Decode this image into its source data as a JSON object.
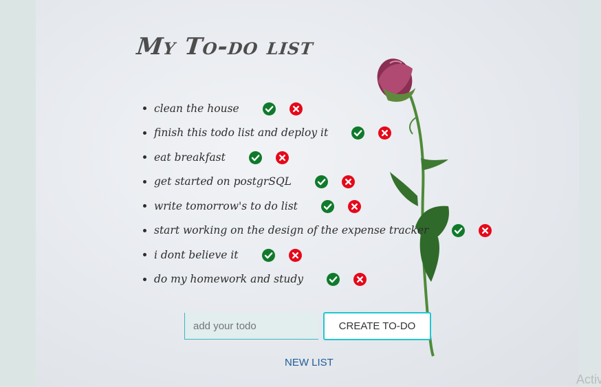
{
  "page": {
    "title": "My To-do list",
    "input_placeholder": "add your todo",
    "create_button": "CREATE TO-DO",
    "new_list_link": "NEW LIST",
    "watermark": "Activ"
  },
  "todos": [
    {
      "text": "clean the house"
    },
    {
      "text": "finish this todo list and deploy it"
    },
    {
      "text": "eat breakfast"
    },
    {
      "text": "get started on postgrSQL"
    },
    {
      "text": "write tomorrow's to do list"
    },
    {
      "text": "start working on the design of the expense tracker"
    },
    {
      "text": "i dont believe it"
    },
    {
      "text": "do my homework and study"
    }
  ],
  "colors": {
    "check": "#0f7a2b",
    "delete": "#e5091a",
    "accent": "#1ec7d0",
    "link": "#1f5c99"
  },
  "icons": {
    "check": "check-circle-icon",
    "delete": "x-circle-icon"
  }
}
